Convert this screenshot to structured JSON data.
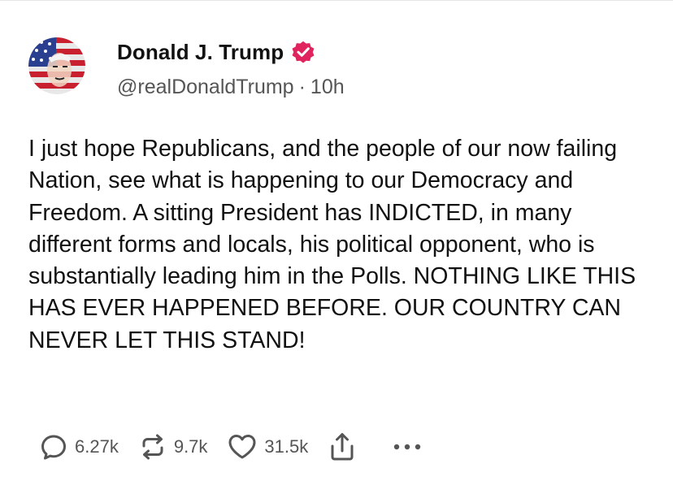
{
  "post": {
    "author_name": "Donald J. Trump",
    "handle": "@realDonaldTrump",
    "separator": "·",
    "timestamp": "10h",
    "text": "I just hope Republicans, and the people of our now failing Nation, see what is happening to our Democracy and Freedom. A sitting President has INDICTED, in many different forms and locals, his political opponent, who is substantially leading him in the Polls. NOTHING LIKE THIS HAS EVER HAPPENED BEFORE. OUR COUNTRY CAN NEVER LET THIS STAND!"
  },
  "actions": {
    "reply_count": "6.27k",
    "repost_count": "9.7k",
    "like_count": "31.5k"
  },
  "icons": {
    "avatar": "avatar-image",
    "verified": "verified-badge-icon",
    "reply": "reply-icon",
    "repost": "repost-icon",
    "like": "heart-icon",
    "share": "share-icon",
    "more": "more-icon"
  },
  "colors": {
    "verified_badge": "#e0245e",
    "icon_gray": "#555555"
  }
}
